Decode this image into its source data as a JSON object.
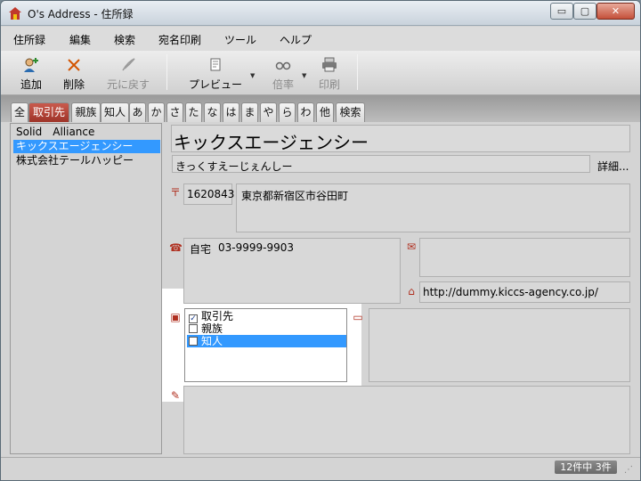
{
  "window": {
    "title": "O's Address - 住所録",
    "minimize_glyph": "▭",
    "maximize_glyph": "▢",
    "close_glyph": "✕"
  },
  "menu": [
    "住所録",
    "編集",
    "検索",
    "宛名印刷",
    "ツール",
    "ヘルプ"
  ],
  "toolbar": {
    "add": {
      "label": "追加",
      "icon": "add-person-icon"
    },
    "delete": {
      "label": "削除",
      "icon": "delete-x-icon"
    },
    "undo": {
      "label": "元に戻す",
      "icon": "undo-feather-icon"
    },
    "preview": {
      "label": "プレビュー",
      "icon": "preview-icon"
    },
    "zoom": {
      "label": "倍率",
      "icon": "glasses-icon"
    },
    "print": {
      "label": "印刷",
      "icon": "printer-icon"
    }
  },
  "tabs": [
    "全",
    "取引先",
    "親族",
    "知人",
    "あ",
    "か",
    "さ",
    "た",
    "な",
    "は",
    "ま",
    "や",
    "ら",
    "わ",
    "他",
    "検索"
  ],
  "active_tab": "取引先",
  "list": {
    "items": [
      "Solid　Alliance",
      "キックスエージェンシー",
      "株式会社テールハッピー"
    ],
    "selected_index": 1
  },
  "record": {
    "name": "キックスエージェンシー",
    "reading": "きっくすえーじぇんしー",
    "details_link": "詳細...",
    "postal_code": "1620843",
    "address": "東京都新宿区市谷田町",
    "phone_label": "自宅",
    "phone": "03-9999-9903",
    "url": "http://dummy.kiccs-agency.co.jp/",
    "groups": [
      {
        "label": "取引先",
        "checked": true
      },
      {
        "label": "親族",
        "checked": false
      },
      {
        "label": "知人",
        "checked": false
      }
    ]
  },
  "status": {
    "count": "12件中  3件"
  },
  "colors": {
    "accent": "#b03020",
    "selection": "#3399ff",
    "active_tab": "#9e3328"
  }
}
